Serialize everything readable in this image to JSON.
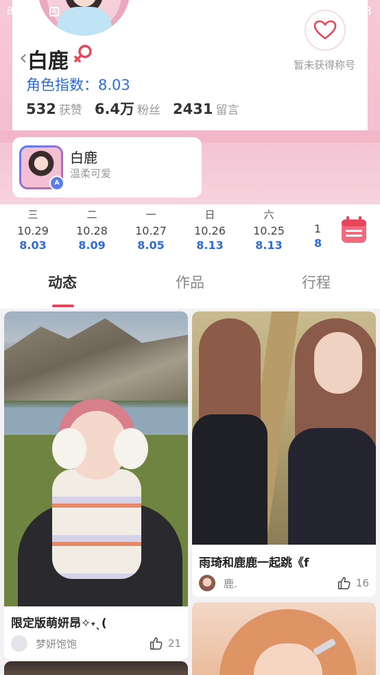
{
  "status_bar": {
    "left": "8",
    "right": "8"
  },
  "profile": {
    "name": "白鹿",
    "role_index": "角色指数：8.03",
    "stats": [
      {
        "num": "532",
        "label": "获赞"
      },
      {
        "num": "6.4万",
        "label": "粉丝"
      },
      {
        "num": "2431",
        "label": "留言"
      }
    ],
    "title_status": "暂未获得称号"
  },
  "role_card": {
    "name": "白鹿",
    "desc": "温柔可爱",
    "badge": "A"
  },
  "dates": [
    {
      "weekday": "三",
      "date": "10.29",
      "score": "8.03"
    },
    {
      "weekday": "二",
      "date": "10.28",
      "score": "8.09"
    },
    {
      "weekday": "一",
      "date": "10.27",
      "score": "8.05"
    },
    {
      "weekday": "日",
      "date": "10.26",
      "score": "8.13"
    },
    {
      "weekday": "六",
      "date": "10.25",
      "score": "8.13"
    },
    {
      "weekday": "",
      "date": "1",
      "score": "8"
    }
  ],
  "tabs": [
    "动态",
    "作品",
    "行程"
  ],
  "feed": [
    {
      "title": "限定版萌妍昂✧˖ˎ(",
      "author": "梦妍饱饱",
      "likes": "21"
    },
    {
      "title": "雨琦和鹿鹿一起跳《f",
      "author": "鹿.",
      "likes": "16"
    }
  ],
  "colors": {
    "accent_blue": "#2c6be0",
    "accent_red": "#e8465a",
    "pink": "#f4bfd0"
  }
}
